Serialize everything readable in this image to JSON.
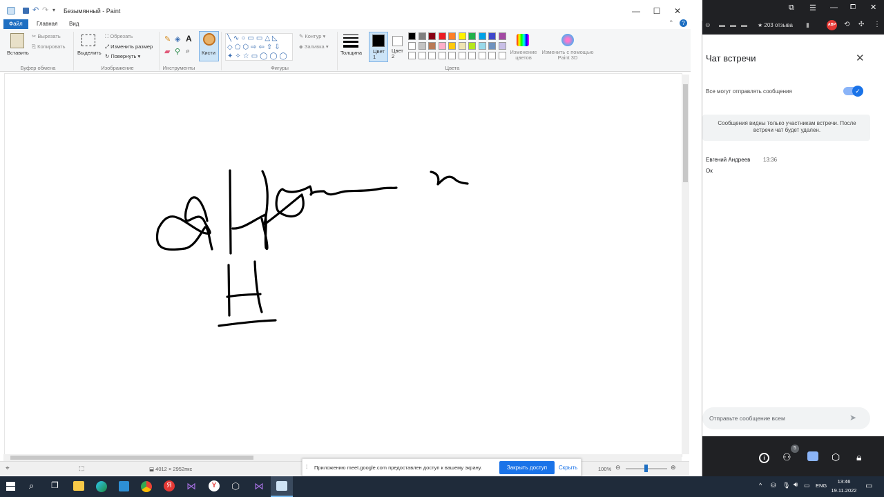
{
  "window": {
    "title": "Безымянный - Paint",
    "min": "—",
    "max": "☐",
    "close": "✕"
  },
  "menu": {
    "file": "Файл",
    "home": "Главная",
    "view": "Вид"
  },
  "ribbon": {
    "clipboard": {
      "paste": "Вставить",
      "cut": "Вырезать",
      "copy": "Копировать",
      "label": "Буфер обмена"
    },
    "image": {
      "select": "Выделить",
      "crop": "Обрезать",
      "resize": "Изменить размер",
      "rotate": "Повернуть",
      "label": "Изображение"
    },
    "tools": {
      "label": "Инструменты",
      "brushes": "Кисти"
    },
    "shapes": {
      "outline": "Контур",
      "fill": "Заливка",
      "label": "Фигуры"
    },
    "size": "Толщина",
    "color1": "Цвет 1",
    "color2": "Цвет 2",
    "colors_label": "Цвета",
    "edit_colors": "Изменение цветов",
    "paint3d": "Изменить с помощью Paint 3D",
    "palette": [
      "#000000",
      "#7f7f7f",
      "#880015",
      "#ed1c24",
      "#ff7f27",
      "#fff200",
      "#22b14c",
      "#00a2e8",
      "#3f48cc",
      "#a349a4",
      "#ffffff",
      "#c3c3c3",
      "#b97a57",
      "#ffaec9",
      "#ffc90e",
      "#efe4b0",
      "#b5e61d",
      "#99d9ea",
      "#7092be",
      "#c8bfe7"
    ]
  },
  "status": {
    "dimensions": "4012 × 2952пкс",
    "zoom": "100%"
  },
  "share_bar": {
    "text": "Приложению meet.google.com предоставлен доступ к вашему экрану.",
    "stop": "Закрыть доступ",
    "hide": "Скрыть"
  },
  "chrome": {
    "reviews": "★ 203 отзыва",
    "abp": "ABP"
  },
  "chat": {
    "title": "Чат встречи",
    "toggle_label": "Все могут отправлять сообщения",
    "notice": "Сообщения видны только участникам встречи. После встречи чат будет удален.",
    "author": "Евгений Андреев",
    "time": "13:36",
    "message": "Ок",
    "input_placeholder": "Отправьте сообщение всем"
  },
  "meet": {
    "participants_count": "5"
  },
  "tray": {
    "lang": "ENG",
    "time": "13:46",
    "date": "19.11.2022"
  }
}
